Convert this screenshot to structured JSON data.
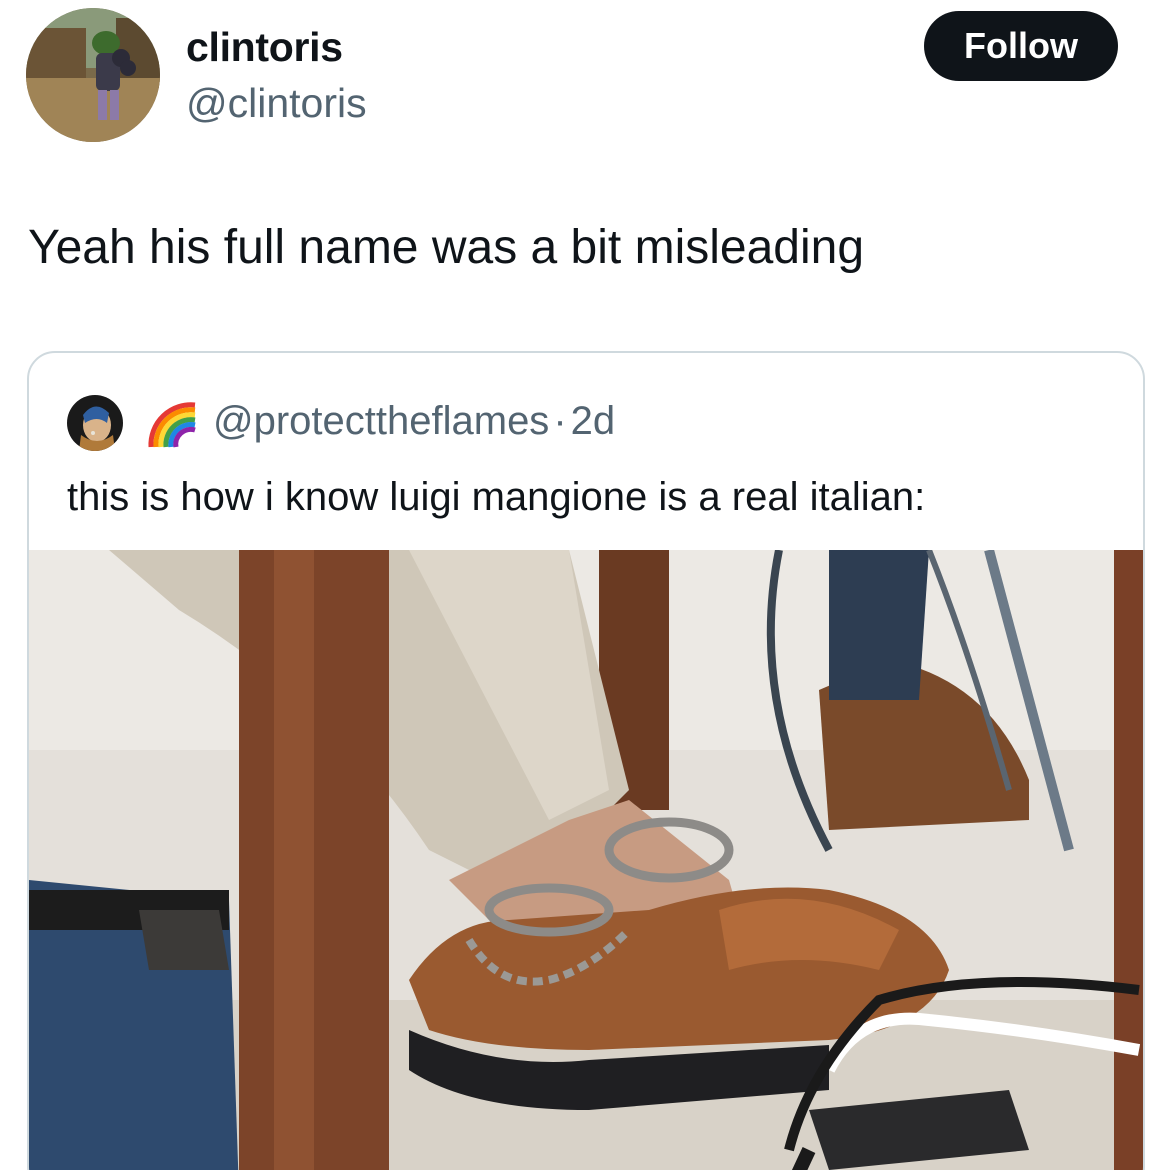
{
  "author": {
    "display_name": "clintoris",
    "handle": "@clintoris",
    "avatar_icon": "profile-avatar"
  },
  "follow_button": {
    "label": "Follow"
  },
  "tweet": {
    "text": "Yeah his full name was a bit misleading"
  },
  "quoted_tweet": {
    "handle": "@protecttheflames",
    "separator": "·",
    "age": "2d",
    "badge_icon": "rainbow-icon",
    "text": "this is how i know luigi mangione is a real italian:",
    "image_icon": "shackled-feet-photo"
  },
  "colors": {
    "text_primary": "#0f1419",
    "text_secondary": "#536471",
    "button_bg": "#0f1419",
    "border": "#cfd9de"
  }
}
